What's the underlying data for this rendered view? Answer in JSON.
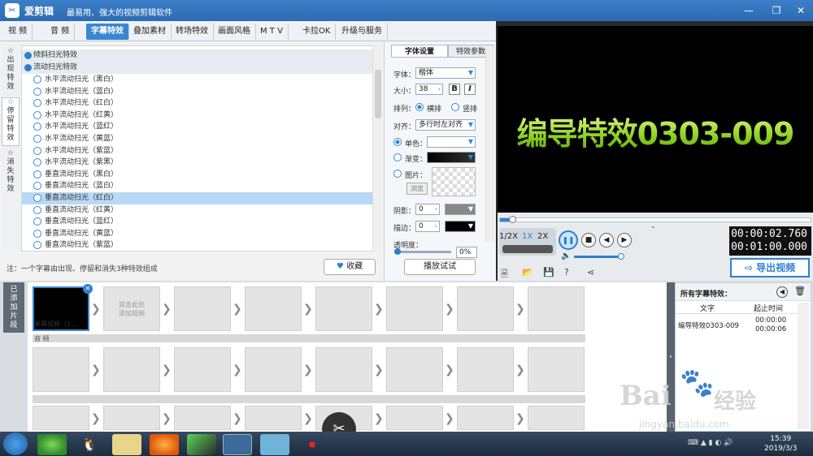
{
  "app": {
    "name": "爱剪辑",
    "slogan": "最易用、强大的视频剪辑软件"
  },
  "tabs": [
    "视  频",
    "音  频",
    "字幕特效",
    "叠加素材",
    "转场特效",
    "画面风格",
    "M T V",
    "卡拉OK",
    "升级与服务"
  ],
  "side_tabs": [
    "出现特效",
    "停留特效",
    "消失特效"
  ],
  "categories": [
    "倾斜扫光特效",
    "流动扫光特效"
  ],
  "effects": [
    "水平流动扫光（黑白）",
    "水平流动扫光（蓝白）",
    "水平流动扫光（红白）",
    "水平流动扫光（红黄）",
    "水平流动扫光（蓝红）",
    "水平流动扫光（黄蓝）",
    "水平流动扫光（紫蓝）",
    "水平流动扫光（紫黑）",
    "垂直流动扫光（黑白）",
    "垂直流动扫光（蓝白）",
    "垂直流动扫光（红白）",
    "垂直流动扫光（红黄）",
    "垂直流动扫光（蓝红）",
    "垂直流动扫光（黄蓝）",
    "垂直流动扫光（紫蓝）"
  ],
  "note": "注：一个字幕由出现、停留和消失3种特效组成",
  "collect_btn": "收藏",
  "settings": {
    "tab_font": "字体设置",
    "tab_params": "特效参数",
    "font_label": "字体：",
    "font_value": "楷体",
    "size_label": "大小：",
    "size_value": "38",
    "bold": "B",
    "italic": "I",
    "layout_label": "排列：",
    "horizontal": "横排",
    "vertical": "竖排",
    "align_label": "对齐：",
    "align_value": "多行时左对齐",
    "solid_label": "单色：",
    "gradient_label": "渐变：",
    "image_label": "图片：",
    "browse": "浏览",
    "shadow_label": "阴影：",
    "shadow_value": "0",
    "stroke_label": "描边：",
    "stroke_value": "0",
    "opacity_label": "透明度：",
    "opacity_value": "0%",
    "playtest": "播放试试"
  },
  "preview": {
    "text": "编导特效0303-009"
  },
  "player": {
    "speeds": [
      "1/2X",
      "1X",
      "2X"
    ],
    "current_time": "00:00:02.760",
    "total_time": "00:01:00.000",
    "export": "导出视频"
  },
  "timeline": {
    "added_label": "已添加片段",
    "clip_name": "黑幕视频（1...",
    "add_hint": "双击此处\n添加视频",
    "audio_label": "音  频"
  },
  "panel": {
    "title": "所有字幕特效：",
    "col_text": "文字",
    "col_time": "起止时间",
    "row_text": "编导特效0303-009",
    "row_start": "00:00:00",
    "row_end": "00:00:06"
  },
  "clock": {
    "time": "15:39",
    "date": "2019/3/3"
  },
  "watermark": {
    "brand": "Bai",
    "brand2": "经验",
    "url": "jingyan.baidu.com"
  }
}
